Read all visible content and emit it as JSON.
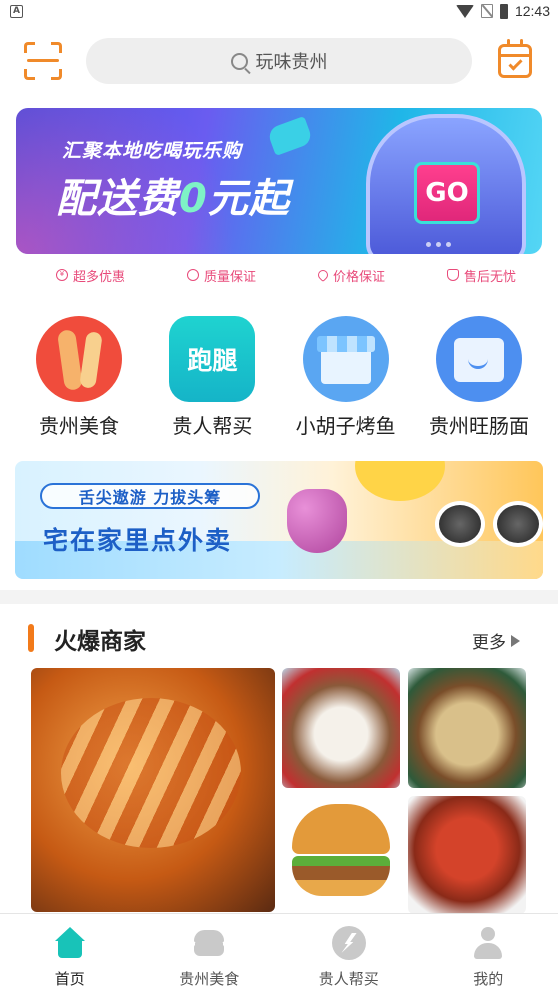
{
  "status_bar": {
    "time": "12:43",
    "left_badge": "A",
    "icons": [
      "notification-a-icon",
      "wifi-icon",
      "no-sim-icon",
      "battery-icon"
    ]
  },
  "header": {
    "search_placeholder": "玩味贵州",
    "left_icon": "scan-icon",
    "right_icon": "calendar-check-icon"
  },
  "banner": {
    "line1": "汇聚本地吃喝玩乐购",
    "line2_prefix": "配送费",
    "line2_highlight": "0",
    "line2_suffix": "元起",
    "go_label": "GO"
  },
  "features": [
    {
      "label": "超多优惠",
      "icon": "yen-circle-icon"
    },
    {
      "label": "质量保证",
      "icon": "quality-icon"
    },
    {
      "label": "价格保证",
      "icon": "heart-icon"
    },
    {
      "label": "售后无忧",
      "icon": "shield-icon"
    }
  ],
  "categories": [
    {
      "label": "贵州美食",
      "icon": "hotdog-icon"
    },
    {
      "label": "贵人帮买",
      "icon": "run-errand-icon",
      "icon_text": "跑腿"
    },
    {
      "label": "小胡子烤鱼",
      "icon": "shop-icon"
    },
    {
      "label": "贵州旺肠面",
      "icon": "shopping-bag-icon"
    }
  ],
  "promo": {
    "pill_text": "舌尖遨游 力拔头筹",
    "title": "宅在家里点外卖"
  },
  "hot_shops": {
    "title": "火爆商家",
    "more_label": "更多"
  },
  "tab_bar": {
    "tabs": [
      {
        "label": "首页",
        "icon": "home-icon",
        "active": true
      },
      {
        "label": "贵州美食",
        "icon": "burger-icon",
        "active": false
      },
      {
        "label": "贵人帮买",
        "icon": "lightning-icon",
        "active": false
      },
      {
        "label": "我的",
        "icon": "user-icon",
        "active": false
      }
    ]
  },
  "colors": {
    "accent": "#f08a2a",
    "teal": "#18c3b8",
    "pink": "#e84a7a",
    "blue": "#1d5fc6"
  }
}
